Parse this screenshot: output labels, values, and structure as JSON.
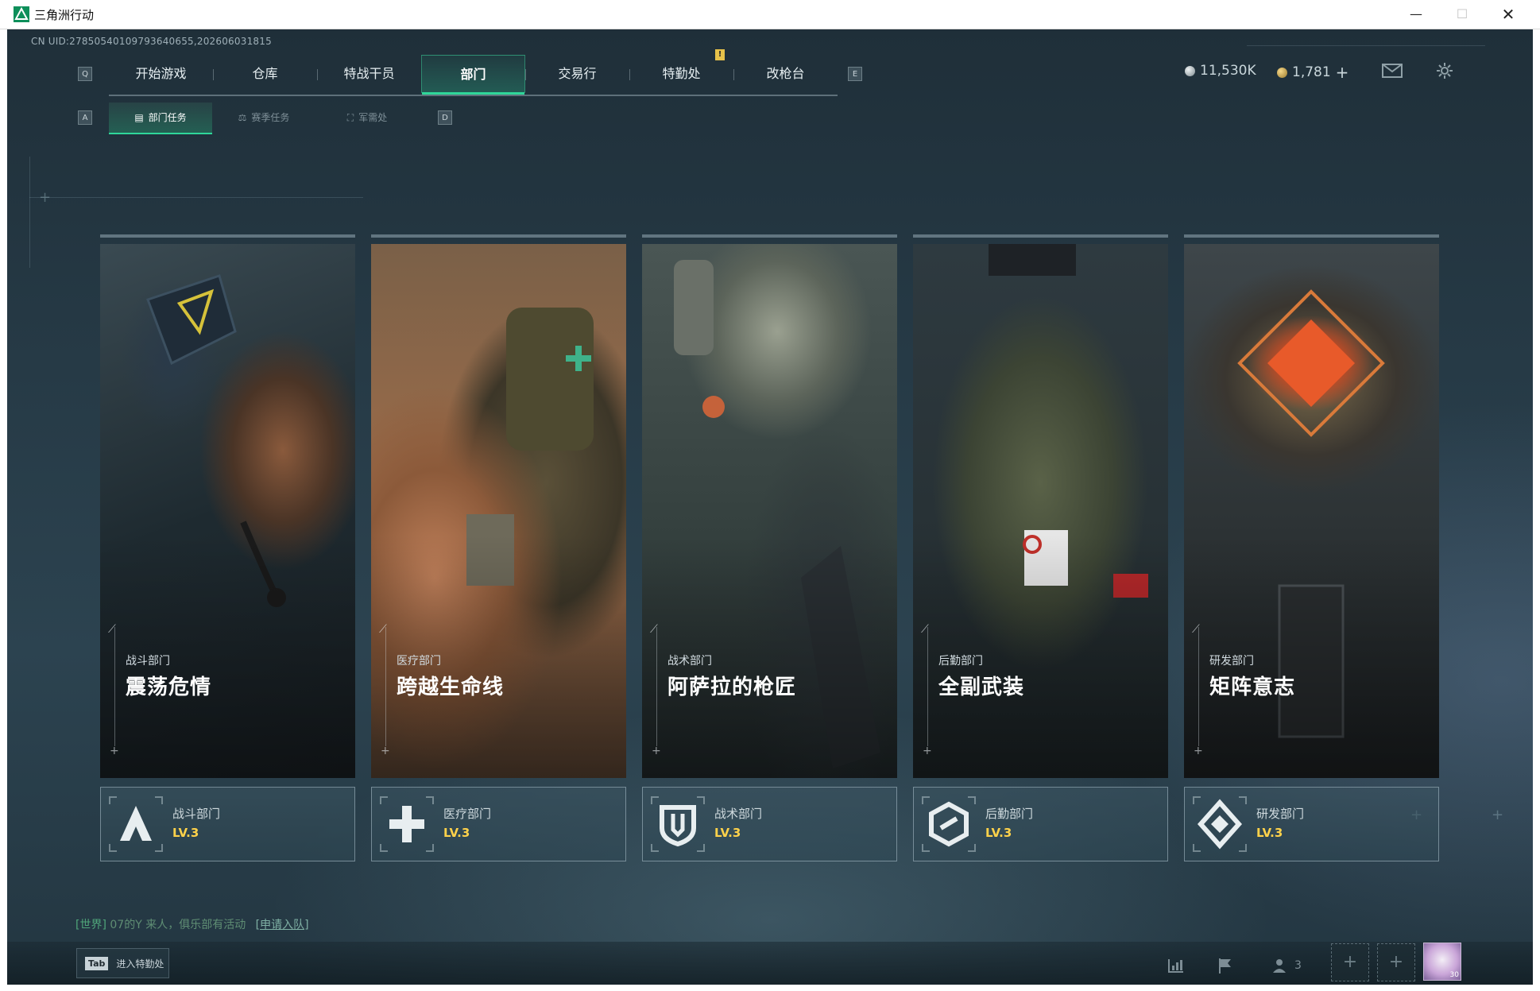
{
  "window": {
    "title": "三角洲行动",
    "minimize": "—",
    "maximize": "☐",
    "close": "✕"
  },
  "game": {
    "uid": "CN UID:27850540109793640655,202606031815",
    "nav": {
      "left_key": "Q",
      "right_key": "E",
      "alert": "!",
      "tabs": [
        {
          "label": "开始游戏"
        },
        {
          "label": "仓库"
        },
        {
          "label": "特战干员"
        },
        {
          "label": "部门"
        },
        {
          "label": "交易行"
        },
        {
          "label": "特勤处"
        },
        {
          "label": "改枪台"
        }
      ],
      "active_index": 3
    },
    "currency": {
      "silver": "11,530K",
      "gold": "1,781",
      "add": "+"
    },
    "subnav": {
      "left_key": "A",
      "right_key": "D",
      "tabs": [
        {
          "label": "部门任务"
        },
        {
          "label": "赛季任务"
        },
        {
          "label": "军需处"
        }
      ],
      "active_index": 0
    },
    "departments": [
      {
        "subtitle": "战斗部门",
        "title": "震荡危情",
        "name": "战斗部门",
        "level": "LV.3"
      },
      {
        "subtitle": "医疗部门",
        "title": "跨越生命线",
        "name": "医疗部门",
        "level": "LV.3"
      },
      {
        "subtitle": "战术部门",
        "title": "阿萨拉的枪匠",
        "name": "战术部门",
        "level": "LV.3"
      },
      {
        "subtitle": "后勤部门",
        "title": "全副武装",
        "name": "后勤部门",
        "level": "LV.3"
      },
      {
        "subtitle": "研发部门",
        "title": "矩阵意志",
        "name": "研发部门",
        "level": "LV.3"
      }
    ],
    "chat": {
      "channel": "[世界]",
      "user": "07的Y",
      "message": "来人，俱乐部有活动",
      "link": "[申请入队]"
    },
    "bottom": {
      "tab_key": "Tab",
      "tab_label": "进入特勤处",
      "friend_count": "3",
      "slot_plus": "+",
      "avatar_level": "30"
    },
    "colors": {
      "accent": "#2fd79a",
      "level": "#ffd24a"
    }
  }
}
